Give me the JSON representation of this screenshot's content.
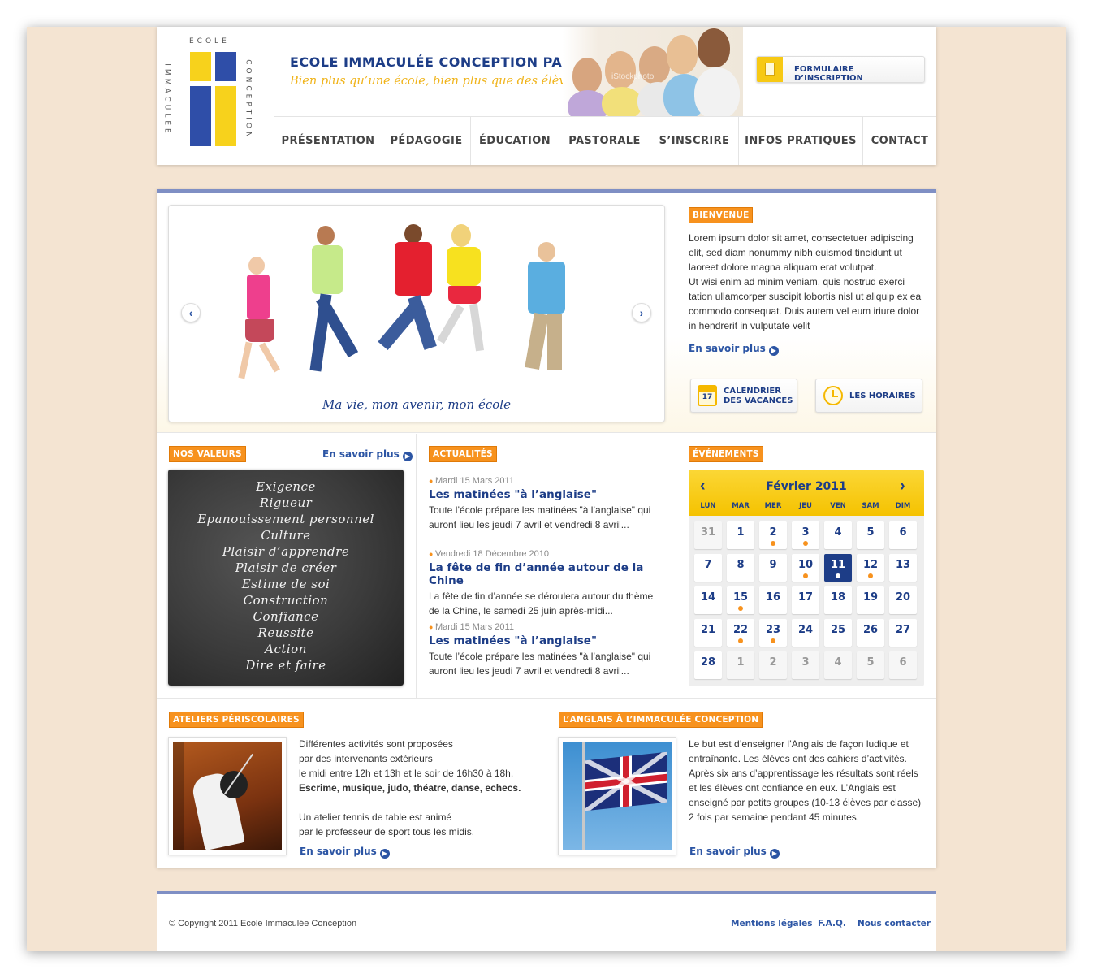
{
  "header": {
    "logo_top": "ECOLE",
    "logo_left": "IMMACULÉE",
    "logo_right": "CONCEPTION",
    "title": "ECOLE IMMACULÉE CONCEPTION PARIS",
    "tagline": "Bien plus qu’une école, bien plus que des élèves",
    "watermark": "iStockphoto",
    "form_button": "FORMULAIRE D’INSCRIPTION"
  },
  "nav": [
    "PRÉSENTATION",
    "PÉDAGOGIE",
    "ÉDUCATION",
    "PASTORALE",
    "S’INSCRIRE",
    "INFOS PRATIQUES",
    "CONTACT"
  ],
  "slider": {
    "caption": "Ma vie, mon avenir, mon école",
    "prev": "‹",
    "next": "›"
  },
  "welcome": {
    "tag": "BIENVENUE",
    "para1": "Lorem ipsum dolor sit amet, consectetuer adipiscing elit, sed diam nonummy nibh euismod tincidunt ut laoreet dolore magna aliquam erat volutpat.",
    "para2": "Ut wisi enim ad minim veniam, quis nostrud exerci tation ullamcorper suscipit lobortis nisl ut aliquip ex ea commodo consequat. Duis autem vel eum iriure dolor in hendrerit in vulputate velit",
    "more": "En savoir plus",
    "calendar_btn_line1": "CALENDRIER",
    "calendar_btn_line2": "DES VACANCES",
    "calendar_icon_num": "17",
    "hours_btn": "LES HORAIRES"
  },
  "values": {
    "tag": "NOS VALEURS",
    "more": "En savoir plus",
    "items": [
      "Exigence",
      "Rigueur",
      "Epanouissement personnel",
      "Culture",
      "Plaisir d’apprendre",
      "Plaisir de créer",
      "Estime de soi",
      "Construction",
      "Confiance",
      "Reussite",
      "Action",
      "Dire et faire"
    ]
  },
  "news": {
    "tag": "ACTUALITÉS",
    "items": [
      {
        "date": "Mardi 15 Mars 2011",
        "title": "Les matinées \"à l’anglaise\"",
        "text": "Toute l’école prépare les matinées \"à l’anglaise\" qui auront lieu les jeudi 7 avril et vendredi 8 avril..."
      },
      {
        "date": "Vendredi 18 Décembre 2010",
        "title": "La fête de fin d’année autour de la Chine",
        "text": "La fête de fin d’année se déroulera autour du thème de la Chine, le samedi 25 juin après-midi..."
      },
      {
        "date": "Mardi 15 Mars 2011",
        "title": "Les matinées \"à l’anglaise\"",
        "text": "Toute l’école prépare les matinées \"à l’anglaise\" qui auront lieu les jeudi 7 avril et vendredi 8 avril..."
      }
    ]
  },
  "events": {
    "tag": "ÉVÉNEMENTS",
    "month": "Février 2011",
    "days_of_week": [
      "LUN",
      "MAR",
      "MER",
      "JEU",
      "VEN",
      "SAM",
      "DIM"
    ],
    "weeks": [
      [
        "31",
        "1",
        "2",
        "3",
        "4",
        "5",
        "6"
      ],
      [
        "7",
        "8",
        "9",
        "10",
        "11",
        "12",
        "13"
      ],
      [
        "14",
        "15",
        "16",
        "17",
        "18",
        "19",
        "20"
      ],
      [
        "21",
        "22",
        "23",
        "24",
        "25",
        "26",
        "27"
      ],
      [
        "28",
        "1",
        "2",
        "3",
        "4",
        "5",
        "6"
      ]
    ],
    "other_month_cells": [
      [
        0,
        0
      ],
      [
        4,
        1
      ],
      [
        4,
        2
      ],
      [
        4,
        3
      ],
      [
        4,
        4
      ],
      [
        4,
        5
      ],
      [
        4,
        6
      ]
    ],
    "event_cells": [
      [
        0,
        2
      ],
      [
        0,
        3
      ],
      [
        1,
        3
      ],
      [
        1,
        4
      ],
      [
        1,
        5
      ],
      [
        2,
        1
      ],
      [
        3,
        1
      ],
      [
        3,
        2
      ]
    ],
    "today_cell": [
      1,
      4
    ]
  },
  "ateliers": {
    "tag": "ATELIERS PÉRISCOLAIRES",
    "lines": [
      "Différentes activités sont proposées",
      "par des intervenants extérieurs",
      "le midi entre 12h et 13h et le soir de 16h30 à 18h."
    ],
    "bold_line": "Escrime, musique, judo, théatre, danse, echecs.",
    "lines2": [
      "Un atelier tennis de table est animé",
      "par le professeur de sport tous les midis."
    ],
    "more": "En savoir plus"
  },
  "anglais": {
    "tag": "L’ANGLAIS À L’IMMACULÉE CONCEPTION",
    "text": "Le but est d’enseigner l’Anglais de façon ludique et entraînante. Les élèves ont des cahiers d’activités. Après six ans d’apprentissage les résultats sont réels et les élèves ont confiance en eux. L’Anglais est enseigné par petits groupes (10-13 élèves par classe) 2 fois par semaine pendant 45 minutes.",
    "more": "En savoir plus"
  },
  "footer": {
    "copyright": "© Copyright 2011 Ecole Immaculée Conception",
    "links": [
      "Mentions légales",
      "F.A.Q.",
      "Nous contacter"
    ]
  },
  "colors": {
    "brand_blue": "#1d3d87",
    "link_blue": "#2c55a4",
    "accent_orange": "#f7921e",
    "accent_yellow": "#f7c914",
    "background": "#f4e4d2"
  }
}
